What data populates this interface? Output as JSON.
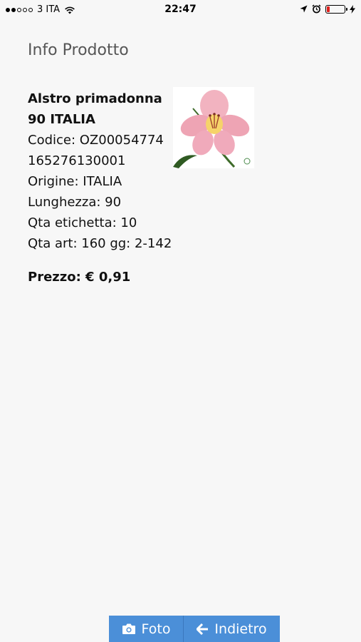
{
  "status_bar": {
    "carrier": "3 ITA",
    "time": "22:47",
    "signal_bars_filled": 2,
    "signal_bars_total": 5,
    "battery_level": 0.15,
    "battery_color": "#e0201c"
  },
  "page": {
    "title": "Info Prodotto"
  },
  "product": {
    "name_line1": "Alstro primadonna",
    "name_line2": "90 ITALIA",
    "codice": "Codice: OZ00054774",
    "barcode": "165276130001",
    "origine": "Origine: ITALIA",
    "lunghezza": "Lunghezza: 90",
    "qta_etichetta": "Qta etichetta: 10",
    "qta_art": "Qta art: 160 gg: 2-142",
    "prezzo": "Prezzo: € 0,91",
    "image_icon": "flower-image"
  },
  "buttons": {
    "foto_label": "Foto",
    "back_label": "Indietro",
    "accent_color": "#4b8fd8"
  }
}
